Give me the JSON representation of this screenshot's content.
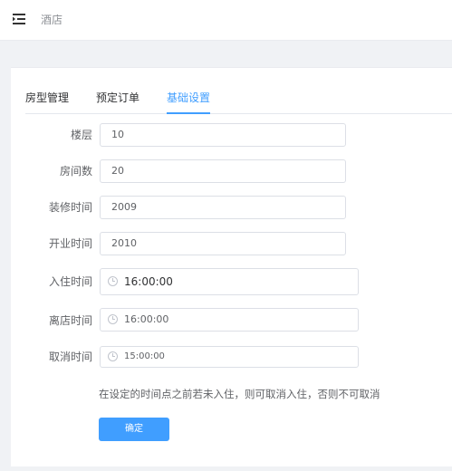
{
  "header": {
    "title": "酒店",
    "menu_icon": "menu-fold-icon"
  },
  "tabs": [
    {
      "label": "房型管理",
      "active": false
    },
    {
      "label": "预定订单",
      "active": false
    },
    {
      "label": "基础设置",
      "active": true
    }
  ],
  "form": {
    "floors": {
      "label": "楼层",
      "value": "10"
    },
    "rooms": {
      "label": "房间数",
      "value": "20"
    },
    "renovation_time": {
      "label": "装修时间",
      "value": "2009"
    },
    "opening_time": {
      "label": "开业时间",
      "value": "2010"
    },
    "checkin_time": {
      "label": "入住时间",
      "value": "16:00:00"
    },
    "checkout_time": {
      "label": "离店时间",
      "value": "16:00:00"
    },
    "cancel_time": {
      "label": "取消时间",
      "value": "15:00:00"
    }
  },
  "tip": "在设定的时间点之前若未入住，则可取消入住，否则不可取消",
  "confirm_label": "确定",
  "colors": {
    "accent": "#409eff",
    "background": "#f0f2f5"
  }
}
